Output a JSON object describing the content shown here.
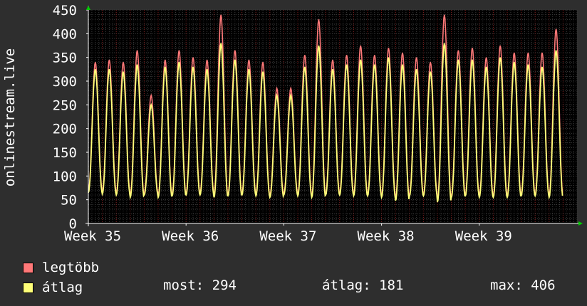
{
  "chart_data": {
    "type": "line",
    "ylabel": "onlinestream.live",
    "ylim": [
      0,
      450
    ],
    "yticks": [
      0,
      50,
      100,
      150,
      200,
      250,
      300,
      350,
      400,
      450
    ],
    "xlim_days": [
      0,
      35
    ],
    "xticks": [
      {
        "label": "Week 35",
        "day": 0
      },
      {
        "label": "Week 36",
        "day": 7
      },
      {
        "label": "Week 37",
        "day": 14
      },
      {
        "label": "Week 38",
        "day": 21
      },
      {
        "label": "Week 39",
        "day": 28
      }
    ],
    "grid": true,
    "series": [
      {
        "name": "legtöbb",
        "color": "#ff7878",
        "daily_peak": [
          340,
          345,
          340,
          365,
          270,
          345,
          365,
          350,
          345,
          440,
          365,
          345,
          340,
          285,
          285,
          355,
          430,
          345,
          355,
          375,
          355,
          370,
          360,
          350,
          340,
          440,
          365,
          370,
          350,
          375,
          360,
          360,
          360,
          410
        ],
        "daily_min": [
          70,
          68,
          65,
          60,
          65,
          60,
          62,
          65,
          65,
          60,
          62,
          65,
          62,
          60,
          65,
          62,
          58,
          65,
          65,
          62,
          62,
          60,
          55,
          62,
          62,
          50,
          60,
          62,
          60,
          60,
          60,
          62,
          62,
          60
        ]
      },
      {
        "name": "átlag",
        "color": "#ffff78",
        "daily_peak": [
          325,
          325,
          320,
          335,
          250,
          330,
          340,
          330,
          325,
          380,
          345,
          325,
          320,
          270,
          270,
          330,
          375,
          325,
          335,
          345,
          335,
          350,
          335,
          325,
          320,
          380,
          345,
          345,
          330,
          350,
          340,
          335,
          330,
          365
        ],
        "daily_min": [
          65,
          62,
          60,
          55,
          60,
          55,
          58,
          60,
          60,
          55,
          58,
          60,
          58,
          55,
          60,
          58,
          55,
          60,
          60,
          58,
          58,
          55,
          48,
          58,
          58,
          45,
          55,
          58,
          55,
          55,
          55,
          58,
          58,
          55
        ]
      }
    ],
    "stats": {
      "current_label": "most:",
      "current": "294",
      "average_label": "átlag:",
      "average": "181",
      "max_label": "max:",
      "max": "406"
    }
  },
  "colors": {
    "background": "#2e2e2e",
    "plot": "#000000",
    "text": "#ffffff",
    "grid": "#3a3a3a",
    "major_grid": "#7a1a1a",
    "axis_arrow": "#00cc00"
  }
}
